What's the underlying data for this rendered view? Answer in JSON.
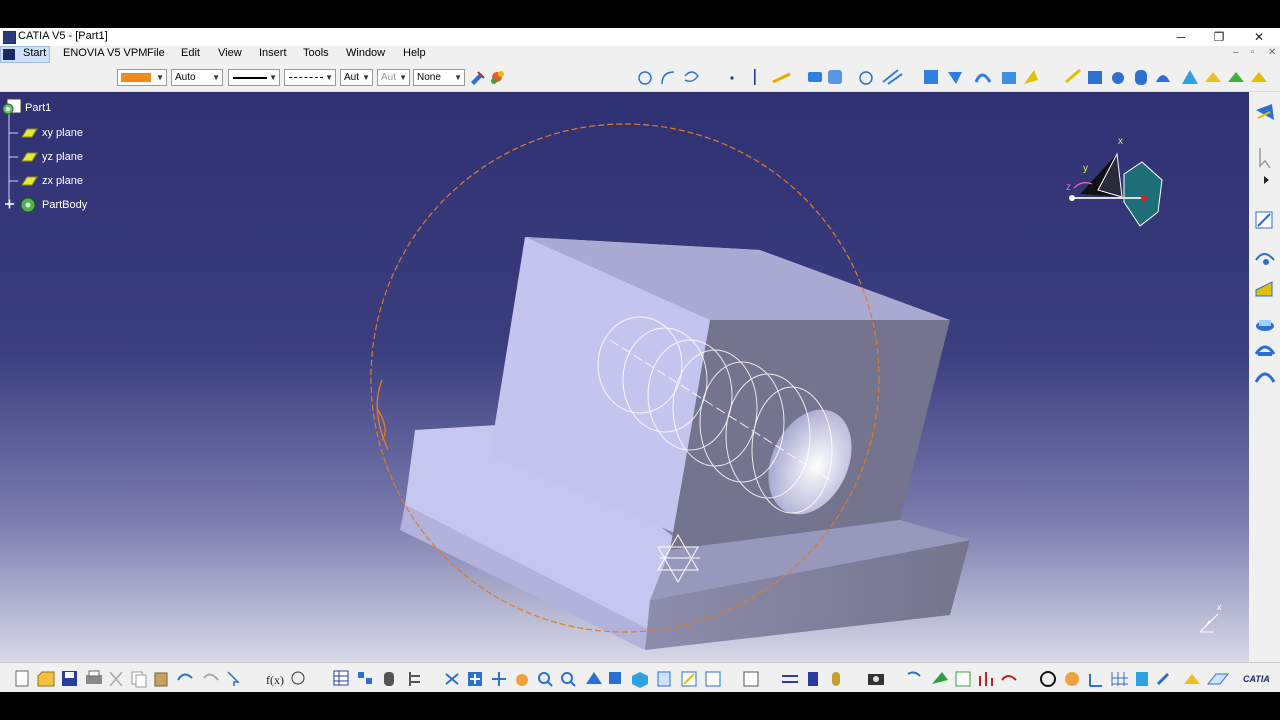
{
  "window": {
    "title": "CATIA V5 - [Part1]",
    "minimize_glyph": "─",
    "restore_glyph": "❐",
    "close_glyph": "✕",
    "doc_min_glyph": "–",
    "doc_restore_glyph": "▫",
    "doc_close_glyph": "✕"
  },
  "menu": {
    "start": "Start",
    "enovia": "ENOVIA V5 VPM",
    "items": [
      "File",
      "Edit",
      "View",
      "Insert",
      "Tools",
      "Window",
      "Help"
    ]
  },
  "graphic_properties": {
    "fill_color": "#f08a1a",
    "transparency": "Auto",
    "line_thickness_value": "Aut",
    "point_symbol_value": "Aut",
    "layer": "None"
  },
  "tree": {
    "root": "Part1",
    "items": [
      "xy plane",
      "yz plane",
      "zx plane",
      "PartBody"
    ]
  },
  "compass": {
    "x_label": "x",
    "y_label": "y",
    "z_label": "z"
  },
  "axis_triad": {
    "x_label": "x"
  },
  "brand": {
    "logo_text": "CATIA"
  },
  "colors": {
    "viewport_top": "#2f3172",
    "viewport_bottom": "#d8d8e6",
    "part_face_light": "#c4c4ee",
    "part_face_dark": "#7a7a96",
    "highlight_orange": "#e07a2a"
  },
  "icons": {
    "top_toolbar": [
      "circle-icon",
      "arc-icon",
      "spline-icon",
      "point-icon",
      "line-icon",
      "plane-icon",
      "extrude-icon",
      "rotate-icon",
      "sphere-icon",
      "axis-icon",
      "select-icon",
      "shape-icon",
      "sweep-icon",
      "loft-icon",
      "fill-icon",
      "join-icon",
      "split-icon",
      "trim-icon",
      "pad-icon",
      "pocket-icon",
      "shaft-icon",
      "hole-icon",
      "rib-icon",
      "slot-icon",
      "stiffener-icon",
      "solid-icon"
    ],
    "right_toolbar": [
      "sketcher-icon",
      "select-arrow-icon",
      "expand-icon",
      "sketch-icon",
      "rotate-axis-icon",
      "multi-section-icon",
      "pad-right-icon",
      "shaft-right-icon",
      "groove-icon"
    ],
    "bottom_toolbar": [
      "new-icon",
      "open-icon",
      "save-icon",
      "print-icon",
      "cut-icon",
      "copy-icon",
      "paste-icon",
      "undo-icon",
      "redo-icon",
      "whats-this-icon",
      "formula-icon",
      "knowledge-icon",
      "macro-icon",
      "table-icon",
      "spreadsheet-icon",
      "measure-icon",
      "fly-icon",
      "fit-all-icon",
      "pan-icon",
      "rotate-view-icon",
      "zoom-in-icon",
      "zoom-out-icon",
      "normal-view-icon",
      "iso-view-icon",
      "front-view-icon",
      "shading-icon",
      "hide-show-icon",
      "swap-icon",
      "photo-icon",
      "capture-icon",
      "analysis-icon",
      "measure-between-icon",
      "curvature-icon",
      "draft-icon",
      "render-icon",
      "material-icon",
      "scene-icon",
      "grid-icon",
      "axis-system-icon",
      "apply-material-icon",
      "parameters-icon",
      "catia-logo-icon"
    ]
  }
}
